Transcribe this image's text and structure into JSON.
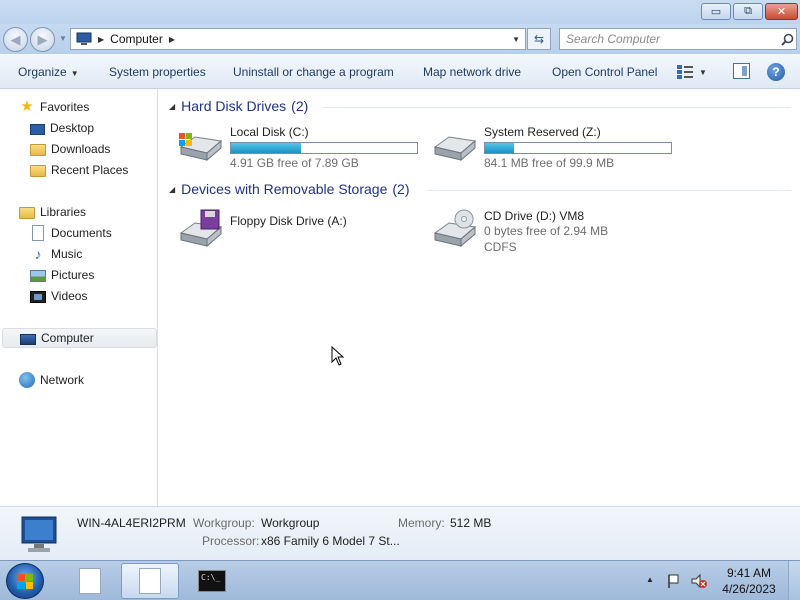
{
  "window": {
    "controls": {
      "minimize": "▭",
      "maximize": "⧉",
      "close": "✕"
    }
  },
  "address": {
    "crumb": "Computer",
    "search_placeholder": "Search Computer"
  },
  "commands": {
    "organize": "Organize",
    "system_properties": "System properties",
    "uninstall": "Uninstall or change a program",
    "map_drive": "Map network drive",
    "control_panel": "Open Control Panel"
  },
  "nav": {
    "favorites": "Favorites",
    "desktop": "Desktop",
    "downloads": "Downloads",
    "recent": "Recent Places",
    "libraries": "Libraries",
    "documents": "Documents",
    "music": "Music",
    "pictures": "Pictures",
    "videos": "Videos",
    "computer": "Computer",
    "network": "Network"
  },
  "groups": {
    "hdd": {
      "title": "Hard Disk Drives",
      "count": "(2)"
    },
    "removable": {
      "title": "Devices with Removable Storage",
      "count": "(2)"
    }
  },
  "drives": {
    "c": {
      "name": "Local Disk (C:)",
      "free": "4.91 GB free of 7.89 GB",
      "used_fraction": 0.378
    },
    "z": {
      "name": "System Reserved (Z:)",
      "free": "84.1 MB free of 99.9 MB",
      "used_fraction": 0.158
    },
    "a": {
      "name": "Floppy Disk Drive (A:)"
    },
    "d": {
      "name": "CD Drive (D:) VM8",
      "free": "0 bytes free of 2.94 MB",
      "fs": "CDFS"
    }
  },
  "details": {
    "computer_name": "WIN-4AL4ERI2PRM",
    "workgroup_label": "Workgroup:",
    "workgroup": "Workgroup",
    "memory_label": "Memory:",
    "memory": "512 MB",
    "processor_label": "Processor:",
    "processor": "x86 Family 6 Model 7 St..."
  },
  "taskbar": {
    "time": "9:41 AM",
    "date": "4/26/2023",
    "cmd_text": "C:\\_"
  }
}
